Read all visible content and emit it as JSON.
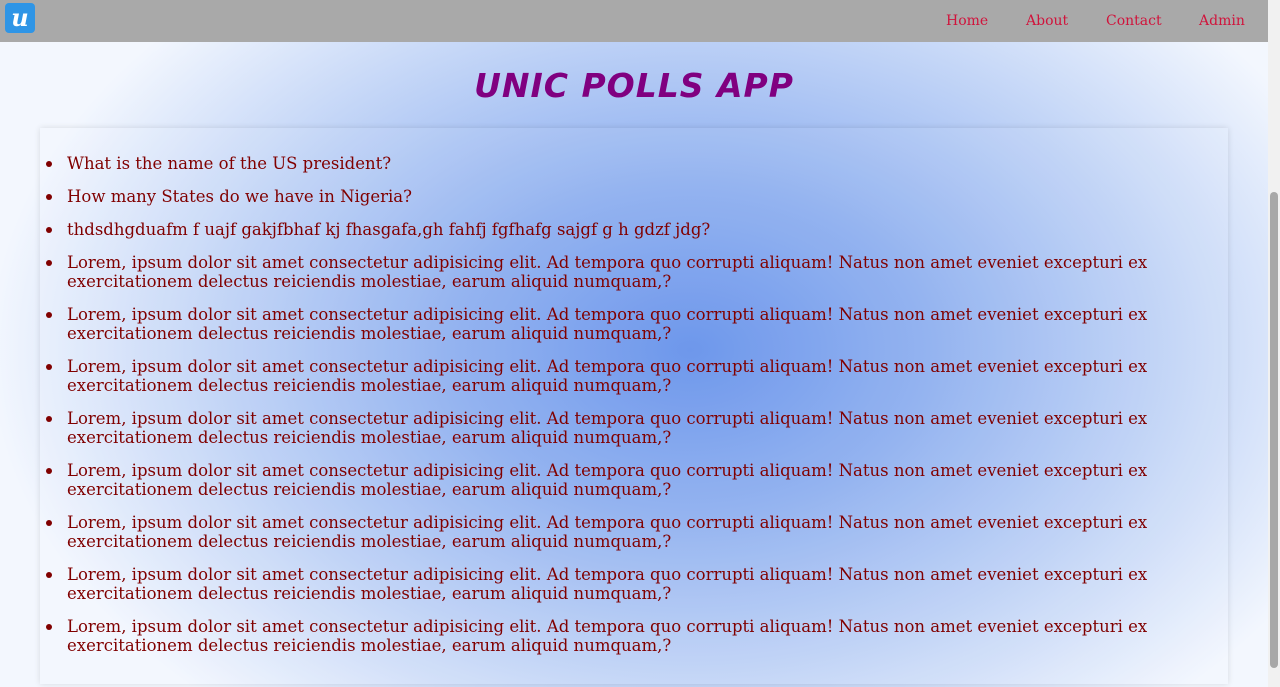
{
  "app": {
    "logo_letter": "u",
    "title": "UNIC POLLS APP"
  },
  "nav": {
    "items": [
      "Home",
      "About",
      "Contact",
      "Admin"
    ]
  },
  "polls": [
    "What is the name of the US president?",
    "How many States do we have in Nigeria?",
    "thdsdhgduafm f uajf gakjfbhaf kj fhasgafa,gh fahfj fgfhafg sajgf g h gdzf jdg?",
    "Lorem, ipsum dolor sit amet consectetur adipisicing elit. Ad tempora quo corrupti aliquam! Natus non amet eveniet excepturi ex exercitationem delectus reiciendis molestiae, earum aliquid numquam,?",
    "Lorem, ipsum dolor sit amet consectetur adipisicing elit. Ad tempora quo corrupti aliquam! Natus non amet eveniet excepturi ex exercitationem delectus reiciendis molestiae, earum aliquid numquam,?",
    "Lorem, ipsum dolor sit amet consectetur adipisicing elit. Ad tempora quo corrupti aliquam! Natus non amet eveniet excepturi ex exercitationem delectus reiciendis molestiae, earum aliquid numquam,?",
    "Lorem, ipsum dolor sit amet consectetur adipisicing elit. Ad tempora quo corrupti aliquam! Natus non amet eveniet excepturi ex exercitationem delectus reiciendis molestiae, earum aliquid numquam,?",
    "Lorem, ipsum dolor sit amet consectetur adipisicing elit. Ad tempora quo corrupti aliquam! Natus non amet eveniet excepturi ex exercitationem delectus reiciendis molestiae, earum aliquid numquam,?",
    "Lorem, ipsum dolor sit amet consectetur adipisicing elit. Ad tempora quo corrupti aliquam! Natus non amet eveniet excepturi ex exercitationem delectus reiciendis molestiae, earum aliquid numquam,?",
    "Lorem, ipsum dolor sit amet consectetur adipisicing elit. Ad tempora quo corrupti aliquam! Natus non amet eveniet excepturi ex exercitationem delectus reiciendis molestiae, earum aliquid numquam,?",
    "Lorem, ipsum dolor sit amet consectetur adipisicing elit. Ad tempora quo corrupti aliquam! Natus non amet eveniet excepturi ex exercitationem delectus reiciendis molestiae, earum aliquid numquam,?"
  ],
  "colors": {
    "nav_bar": "#a9a9a9",
    "nav_link": "#d0143c",
    "title": "#800080",
    "poll_text": "#800000",
    "logo_bg": "#2f95e6"
  },
  "icons": {
    "logo": "u-logo-icon"
  }
}
